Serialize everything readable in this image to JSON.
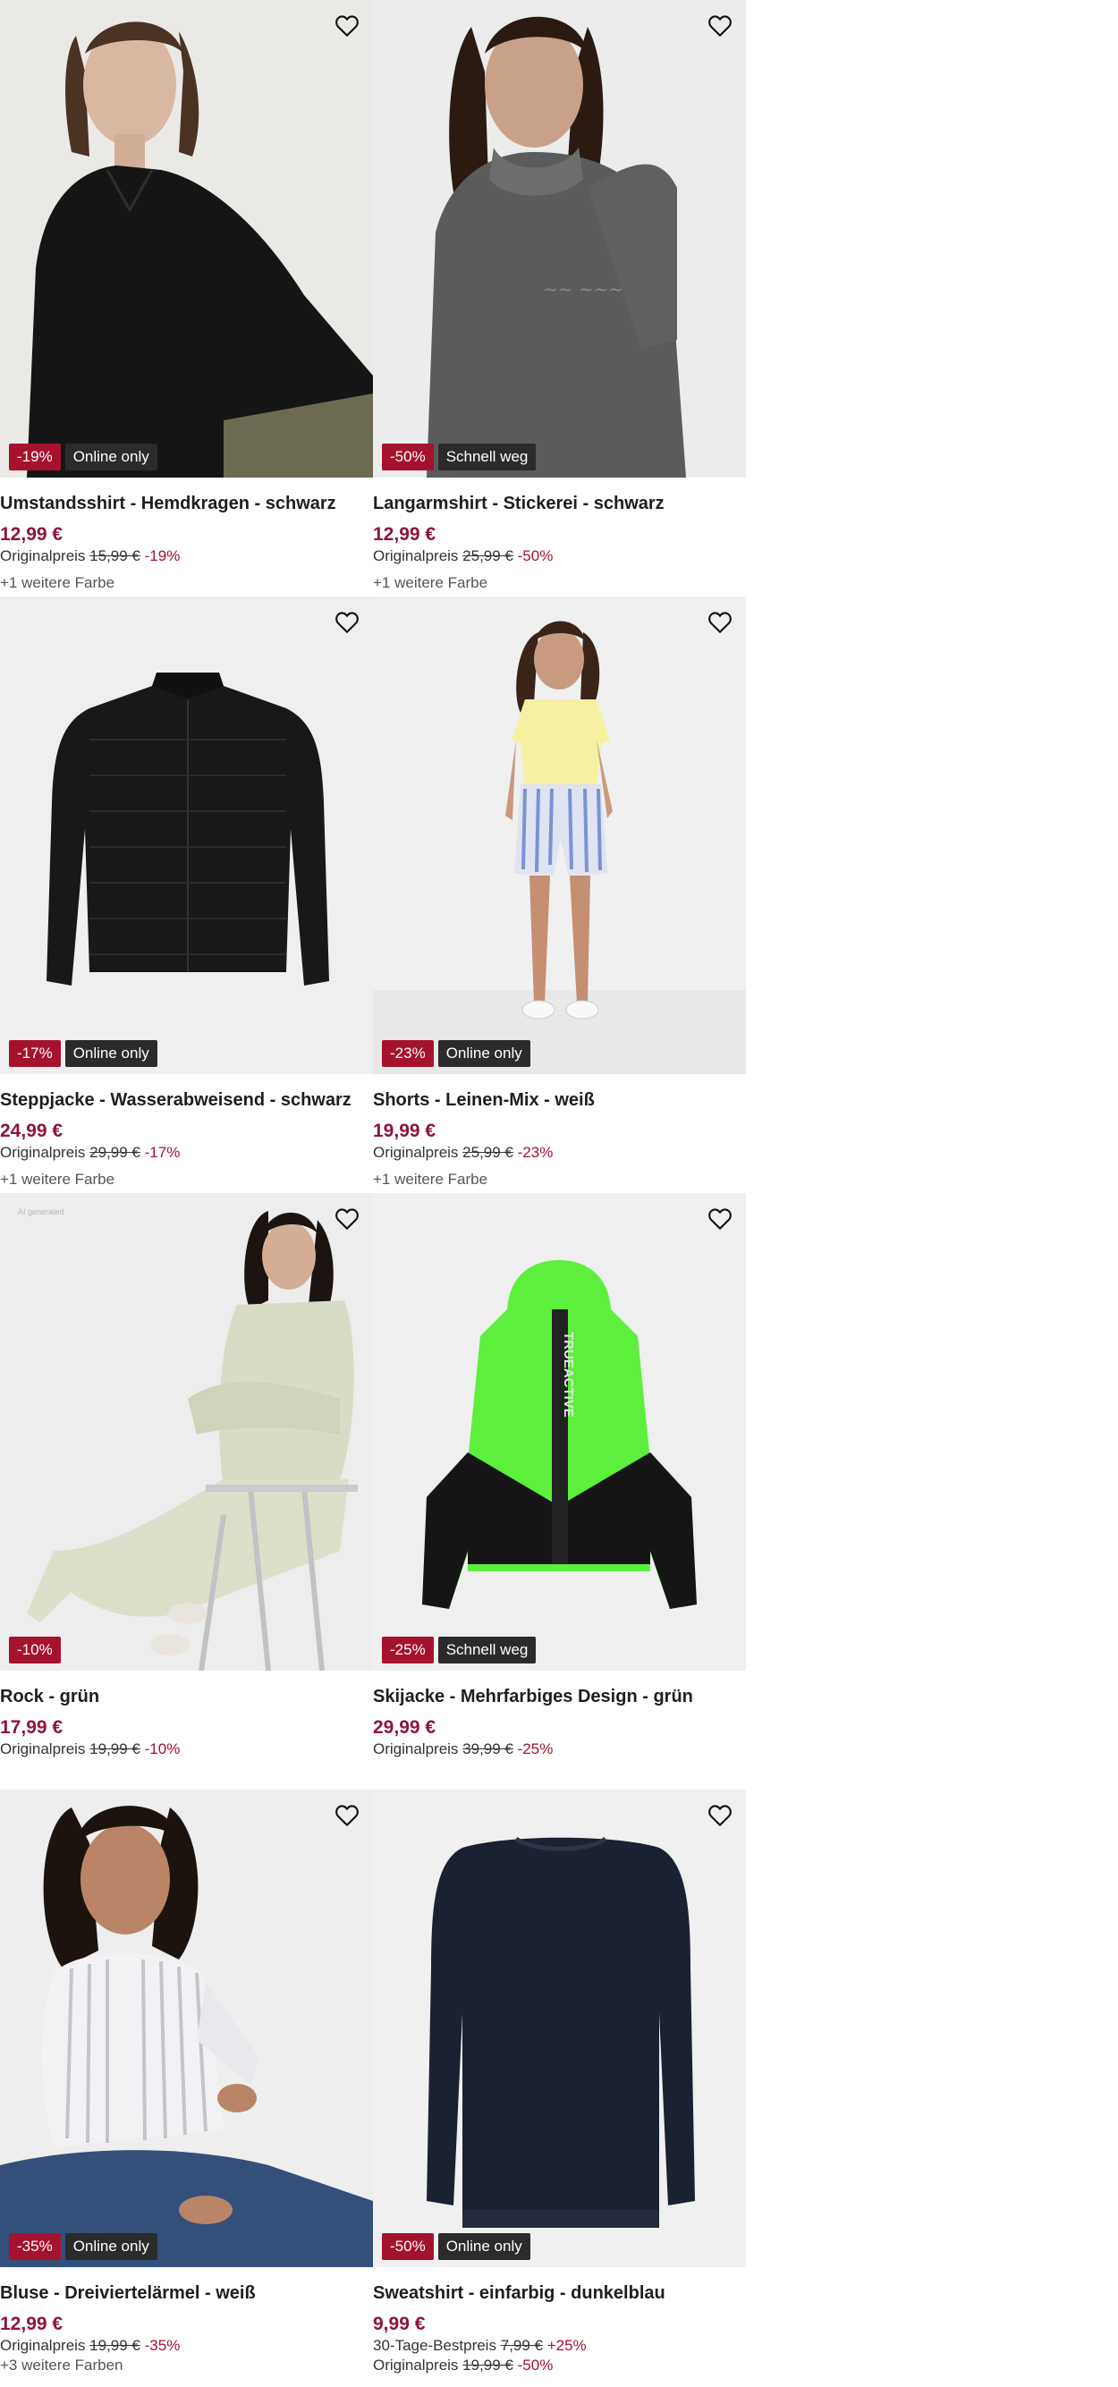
{
  "colors": {
    "accent": "#8e1537",
    "discount_badge": "#a5122e",
    "tag_badge": "#2b2b2b"
  },
  "icons": {
    "favorite": "heart-outline-icon"
  },
  "products": [
    {
      "name": "Umstandsshirt - Hemdkragen - schwarz",
      "price": "12,99 €",
      "badge_discount": "-19%",
      "badge_tag": "Online only",
      "orig_label": "Originalpreis",
      "orig_price": "15,99 €",
      "orig_pct": "-19%",
      "more_colors": "+1 weitere Farbe"
    },
    {
      "name": "Langarmshirt - Stickerei - schwarz",
      "price": "12,99 €",
      "badge_discount": "-50%",
      "badge_tag": "Schnell weg",
      "orig_label": "Originalpreis",
      "orig_price": "25,99 €",
      "orig_pct": "-50%",
      "more_colors": "+1 weitere Farbe"
    },
    {
      "name": "Steppjacke - Wasserabweisend - schwarz",
      "price": "24,99 €",
      "badge_discount": "-17%",
      "badge_tag": "Online only",
      "orig_label": "Originalpreis",
      "orig_price": "29,99 €",
      "orig_pct": "-17%",
      "more_colors": "+1 weitere Farbe"
    },
    {
      "name": "Shorts - Leinen-Mix - weiß",
      "price": "19,99 €",
      "badge_discount": "-23%",
      "badge_tag": "Online only",
      "orig_label": "Originalpreis",
      "orig_price": "25,99 €",
      "orig_pct": "-23%",
      "more_colors": "+1 weitere Farbe"
    },
    {
      "name": "Rock - grün",
      "price": "17,99 €",
      "badge_discount": "-10%",
      "badge_tag": "",
      "image_note": "AI generated",
      "orig_label": "Originalpreis",
      "orig_price": "19,99 €",
      "orig_pct": "-10%",
      "more_colors": ""
    },
    {
      "name": "Skijacke - Mehrfarbiges Design - grün",
      "price": "29,99 €",
      "badge_discount": "-25%",
      "badge_tag": "Schnell weg",
      "garment_print": "TRUEACTIVE",
      "orig_label": "Originalpreis",
      "orig_price": "39,99 €",
      "orig_pct": "-25%",
      "more_colors": ""
    },
    {
      "name": "Bluse - Dreiviertelärmel - weiß",
      "price": "12,99 €",
      "badge_discount": "-35%",
      "badge_tag": "Online only",
      "orig_label": "Originalpreis",
      "orig_price": "19,99 €",
      "orig_pct": "-35%",
      "more_colors": "+3 weitere Farben"
    },
    {
      "name": "Sweatshirt - einfarbig - dunkelblau",
      "price": "9,99 €",
      "badge_discount": "-50%",
      "badge_tag": "Online only",
      "best_label": "30-Tage-Bestpreis",
      "best_price": "7,99 €",
      "best_pct": "+25%",
      "orig_label": "Originalpreis",
      "orig_price": "19,99 €",
      "orig_pct": "-50%",
      "more_colors": ""
    }
  ]
}
